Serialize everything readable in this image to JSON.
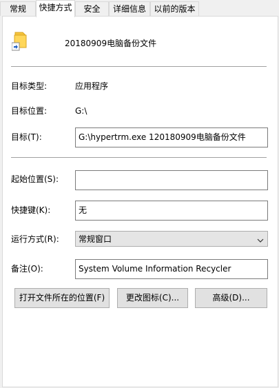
{
  "tabs": [
    {
      "label": "常规"
    },
    {
      "label": "快捷方式"
    },
    {
      "label": "安全"
    },
    {
      "label": "详细信息"
    },
    {
      "label": "以前的版本"
    }
  ],
  "file": {
    "name": "20180909电脑备份文件",
    "icon": "folder-shortcut-icon"
  },
  "properties": {
    "target_type_label": "目标类型:",
    "target_type_value": "应用程序",
    "target_location_label": "目标位置:",
    "target_location_value": "G:\\",
    "target_label": "目标(T):",
    "target_value": "G:\\hypertrm.exe 120180909电脑备份文件",
    "start_in_label": "起始位置(S):",
    "start_in_value": "",
    "shortcut_key_label": "快捷键(K):",
    "shortcut_key_value": "无",
    "run_label": "运行方式(R):",
    "run_value": "常规窗口",
    "comment_label": "备注(O):",
    "comment_value": "System Volume Information Recycler"
  },
  "buttons": {
    "open_location": "打开文件所在的位置(F)",
    "change_icon": "更改图标(C)...",
    "advanced": "高级(D)..."
  },
  "colors": {
    "folder_yellow": "#f5c33b",
    "shortcut_arrow_blue": "#1f5fc4",
    "tab_border": "#d9d9d9"
  }
}
